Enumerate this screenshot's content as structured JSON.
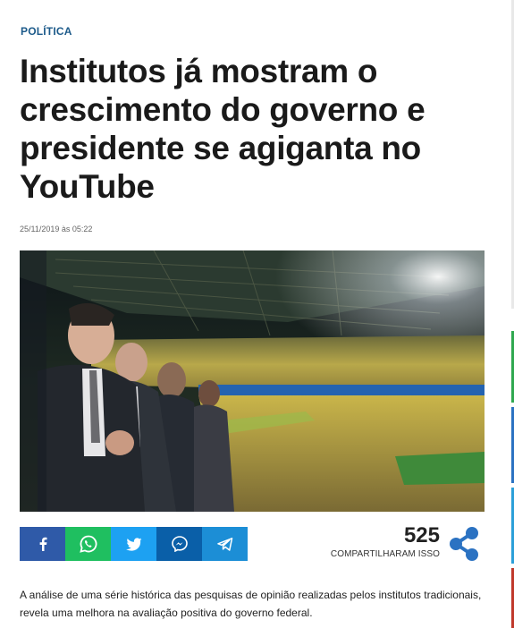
{
  "article": {
    "category": "POLÍTICA",
    "headline": "Institutos já mostram o crescimento do governo e presidente se agiganta no YouTube",
    "date": "25/11/2019 às 05:22",
    "lead": "A análise de uma série histórica das pesquisas de opinião realizadas pelos institutos tradicionais, revela uma melhora na avaliação positiva do governo federal."
  },
  "share": {
    "buttons": [
      {
        "name": "facebook",
        "icon": "facebook-icon",
        "color": "#2f5aa8"
      },
      {
        "name": "whatsapp",
        "icon": "whatsapp-icon",
        "color": "#1fbf60"
      },
      {
        "name": "twitter",
        "icon": "twitter-icon",
        "color": "#1da1f2"
      },
      {
        "name": "messenger",
        "icon": "messenger-icon",
        "color": "#0a5fa8"
      },
      {
        "name": "telegram",
        "icon": "telegram-icon",
        "color": "#1c8ed6"
      }
    ],
    "count": "525",
    "count_label": "COMPARTILHARAM ISSO",
    "share_icon": "share-icon",
    "share_icon_color": "#2b72c2"
  },
  "colors": {
    "category": "#1c5a8a",
    "headline": "#1a1a1a"
  }
}
